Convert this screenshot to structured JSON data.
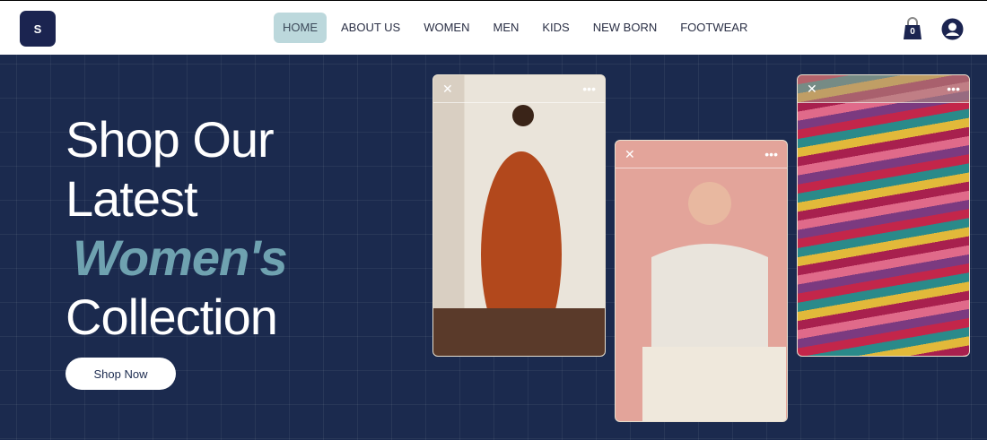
{
  "header": {
    "logo_text": "S",
    "nav": [
      {
        "label": "HOME",
        "active": true
      },
      {
        "label": "ABOUT US"
      },
      {
        "label": "WOMEN"
      },
      {
        "label": "MEN"
      },
      {
        "label": "KIDS"
      },
      {
        "label": "NEW BORN"
      },
      {
        "label": "FOOTWEAR"
      }
    ],
    "cart_count": "0"
  },
  "hero": {
    "line1": "Shop Our",
    "line2": "Latest",
    "accent": "Women's",
    "line4": "Collection",
    "cta": "Shop Now"
  },
  "cards": [
    {
      "close": "✕",
      "menu": "•••"
    },
    {
      "close": "✕",
      "menu": "•••"
    },
    {
      "close": "✕",
      "menu": "•••"
    }
  ]
}
